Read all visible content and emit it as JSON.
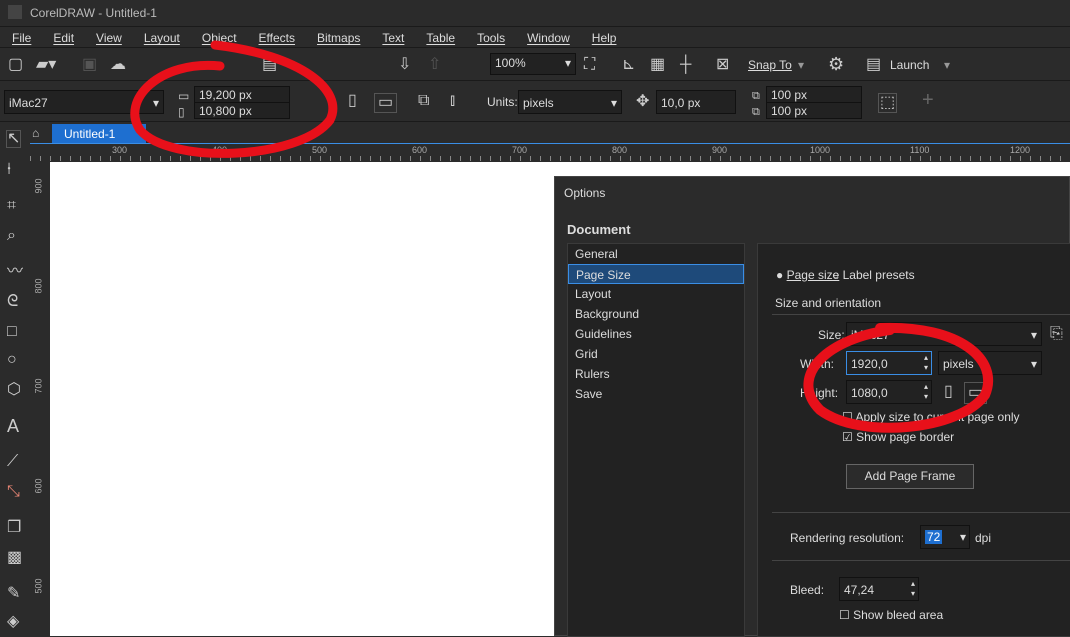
{
  "window": {
    "title": "CorelDRAW - Untitled-1"
  },
  "menu": [
    "File",
    "Edit",
    "View",
    "Layout",
    "Object",
    "Effects",
    "Bitmaps",
    "Text",
    "Table",
    "Tools",
    "Window",
    "Help"
  ],
  "toolbar": {
    "zoom": "100%",
    "snap_to": "Snap To",
    "launch": "Launch"
  },
  "propbar": {
    "preset": "iMac27",
    "width": "19,200 px",
    "height": "10,800 px",
    "units_label": "Units:",
    "units": "pixels",
    "nudge": "10,0 px",
    "dup_x": "100 px",
    "dup_y": "100 px"
  },
  "tabs": {
    "doc": "Untitled-1"
  },
  "ruler": {
    "h": [
      "300",
      "400",
      "500",
      "600",
      "700",
      "800",
      "900",
      "1000",
      "1100",
      "1200"
    ],
    "v": [
      "900",
      "800",
      "700",
      "600",
      "500"
    ]
  },
  "dialog": {
    "title": "Options",
    "section": "Document",
    "categories": [
      "General",
      "Page Size",
      "Layout",
      "Background",
      "Guidelines",
      "Grid",
      "Rulers",
      "Save"
    ],
    "selected": "Page Size",
    "radio_page_size": "Page size",
    "radio_label_presets": "Label presets",
    "group_title": "Size and orientation",
    "size_label": "Size:",
    "size_value": "iMac27",
    "width_label": "Width:",
    "width_value": "1920,0",
    "width_units": "pixels",
    "height_label": "Height:",
    "height_value": "1080,0",
    "apply_current": "Apply size to current page only",
    "show_border": "Show page border",
    "add_frame": "Add Page Frame",
    "rendering_label": "Rendering resolution:",
    "rendering_value": "72",
    "rendering_unit": "dpi",
    "bleed_label": "Bleed:",
    "bleed_value": "47,24",
    "show_bleed": "Show bleed area"
  },
  "colors": {
    "accent": "#3a8ee6",
    "annotation": "#e8101a"
  }
}
